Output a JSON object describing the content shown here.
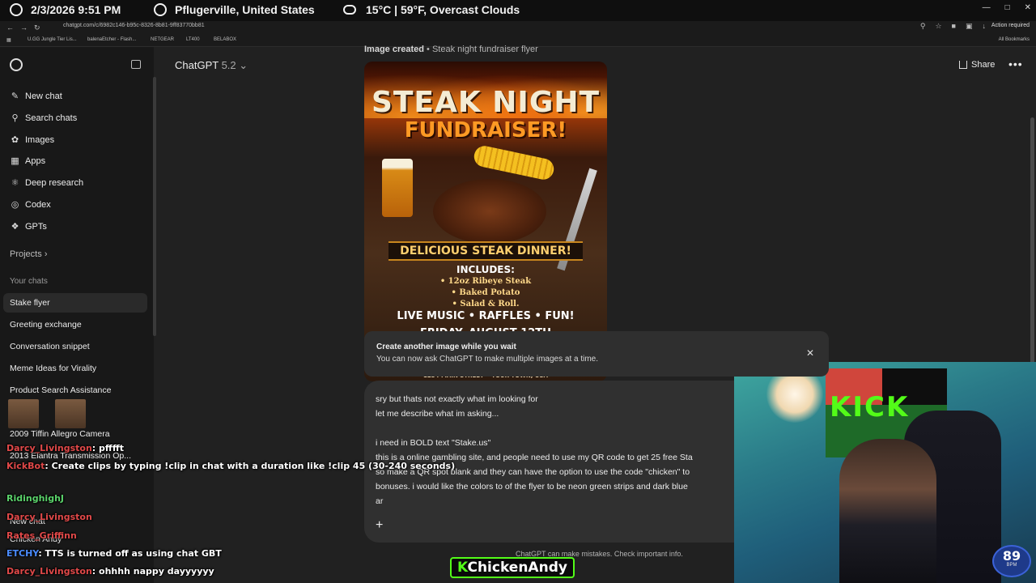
{
  "overlay": {
    "datetime": "2/3/2026 9:51 PM",
    "location": "Pflugerville, United States",
    "weather": "15°C | 59°F, Overcast Clouds"
  },
  "browser": {
    "url": "chatgpt.com/c/6982c146-b95c-8326-8b81-9ff83770bb81",
    "bookmarks": [
      "U.GG Jungle Tier Lis...",
      "balenaEtcher - Flash...",
      "NETGEAR",
      "LT400",
      "BELABOX"
    ],
    "all_bookmarks": "All Bookmarks",
    "action_required": "Action required"
  },
  "sidebar": {
    "nav": [
      {
        "label": "New chat",
        "icon": "pencil-icon"
      },
      {
        "label": "Search chats",
        "icon": "search-icon"
      },
      {
        "label": "Images",
        "icon": "image-icon"
      },
      {
        "label": "Apps",
        "icon": "apps-icon"
      },
      {
        "label": "Deep research",
        "icon": "research-icon"
      },
      {
        "label": "Codex",
        "icon": "codex-icon"
      },
      {
        "label": "GPTs",
        "icon": "gpts-icon"
      }
    ],
    "projects_label": "Projects",
    "your_chats_label": "Your chats",
    "chats": [
      "Stake flyer",
      "Greeting exchange",
      "Conversation snippet",
      "Meme Ideas for Virality",
      "Product Search Assistance"
    ]
  },
  "header": {
    "model_name": "ChatGPT",
    "model_version": "5.2",
    "share_label": "Share"
  },
  "image_caption": {
    "prefix": "Image created",
    "title": "Steak night fundraiser flyer"
  },
  "flyer": {
    "title_line1": "STEAK NIGHT",
    "title_line2": "FUNDRAISER!",
    "banner": "DELICIOUS STEAK DINNER!",
    "includes": "INCLUDES:",
    "items": [
      "• 12oz Ribeye Steak",
      "• Baked Potato",
      "• Salad & Roll."
    ],
    "fun": "LIVE MUSIC • RAFFLES • FUN!",
    "date": "FRIDAY, AUGUST 12TH",
    "address": "1234 MAIN STREET • YOUR TOWN, USA"
  },
  "toast": {
    "title": "Create another image while you wait",
    "subtitle": "You can now ask ChatGPT to make multiple images at a time."
  },
  "composer": {
    "text": "sry but thats not exactly what im looking for\nlet me describe what im asking...\n\ni need in BOLD text \"Stake.us\"\nthis is a online gambling site, and people need to use my QR code to get 25 free Sta\nso make a QR spot blank and they can have the option to use the code \"chicken\" to\nbonuses. i would like the colors to of the flyer to be neon green strips and dark blue\nar"
  },
  "disclaimer": "ChatGPT can make mistakes. Check important info.",
  "webcam": {
    "flag_text": "KICK",
    "heart_rate": "89",
    "heart_rate_unit": "BPM"
  },
  "stream_chat": [
    {
      "user": "Darcy_Livingston",
      "message": "pfffft"
    },
    {
      "user": "KickBot",
      "message": "Create clips by typing !clip in chat with a duration like !clip 45 (30-240 seconds)"
    },
    {
      "user": "RidinghighJ",
      "message": ""
    },
    {
      "user": "Darcy_Livingston",
      "message": ""
    },
    {
      "user": "Rates_Griffinn",
      "message": ""
    },
    {
      "user": "ETCHY",
      "message": "TTS is turned off as using chat GBT"
    },
    {
      "user": "Darcy_Livingston",
      "message": "ohhhh nappy dayyyyyy"
    }
  ],
  "underlay_chats": [
    "2009 Tiffin Allegro Camera",
    "2013 Elantra Transmission Op...",
    "New chat",
    "Chicken Andy"
  ],
  "streamer_name": "ChickenAndy"
}
